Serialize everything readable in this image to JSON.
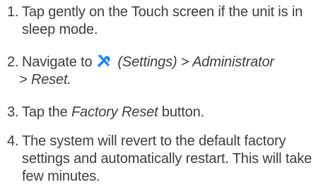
{
  "steps": [
    {
      "number": "1.",
      "text": "Tap gently on the Touch screen if the unit is in sleep mode."
    },
    {
      "number": "2.",
      "prefix": "Navigate to",
      "icon": "settings-icon",
      "settings_label": "(Settings)",
      "path_sep1": " > ",
      "path_item1": "Administrator",
      "path_sep2": " > ",
      "path_item2": "Reset.",
      "line2_prefix": ""
    },
    {
      "number": "3.",
      "prefix": "Tap the ",
      "emphasis": "Factory Reset",
      "suffix": " button."
    },
    {
      "number": "4.",
      "text": "The system will revert to the default factory settings and automatically restart. This will take a few minutes."
    }
  ],
  "colors": {
    "text": "#3d3d3d",
    "icon_blue": "#1e88e5"
  }
}
